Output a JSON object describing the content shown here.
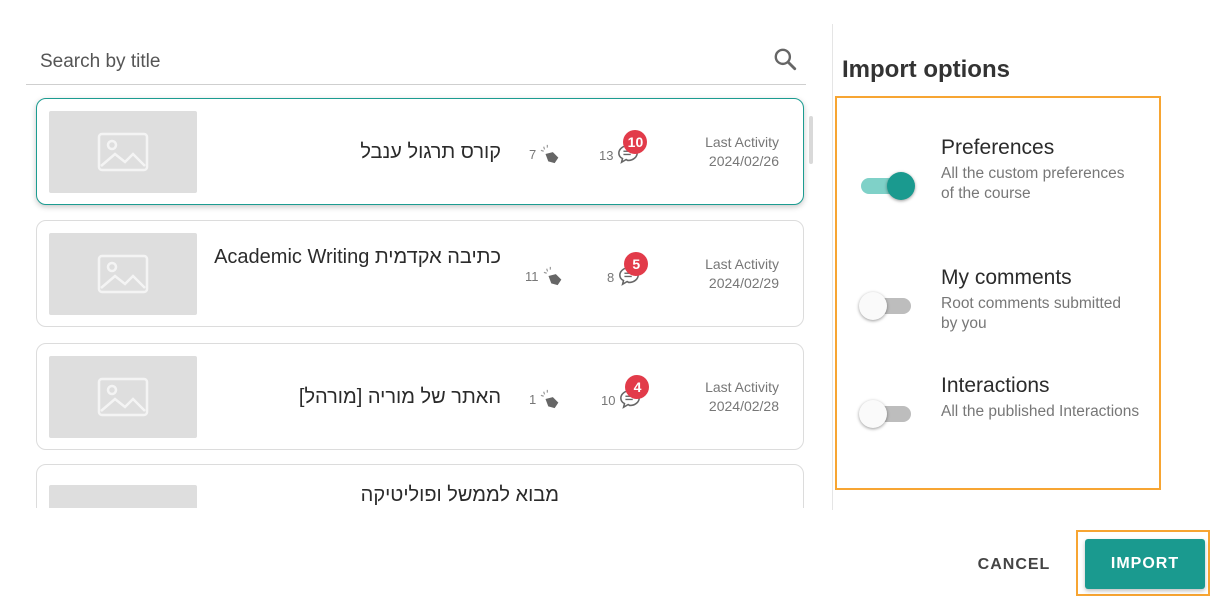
{
  "search": {
    "placeholder": "Search by title",
    "icon": "search-icon"
  },
  "courses": [
    {
      "title": "קורס תרגול ענבל",
      "interactions": "7",
      "comments": "13",
      "badge": "10",
      "activity_label": "Last Activity",
      "activity_date": "2024/02/26",
      "selected": true
    },
    {
      "title": "כתיבה אקדמית Academic Writing",
      "interactions": "11",
      "comments": "8",
      "badge": "5",
      "activity_label": "Last Activity",
      "activity_date": "2024/02/29",
      "selected": false
    },
    {
      "title": "האתר של מוריה [מורהל]",
      "interactions": "1",
      "comments": "10",
      "badge": "4",
      "activity_label": "Last Activity",
      "activity_date": "2024/02/28",
      "selected": false
    },
    {
      "title": "מבוא לממשל ופוליטיקה",
      "selected": false
    }
  ],
  "import_options": {
    "title": "Import options",
    "options": [
      {
        "title": "Preferences",
        "description": "All the custom preferences of the course",
        "enabled": true
      },
      {
        "title": "My comments",
        "description": "Root comments submitted by you",
        "enabled": false
      },
      {
        "title": "Interactions",
        "description": "All the published Interactions",
        "enabled": false
      }
    ]
  },
  "buttons": {
    "cancel": "CANCEL",
    "import": "IMPORT"
  },
  "colors": {
    "accent": "#1a9a8f",
    "highlight": "#f7a532",
    "badge": "#e23b4a",
    "toggle_track_on": "#7fd1c8"
  }
}
